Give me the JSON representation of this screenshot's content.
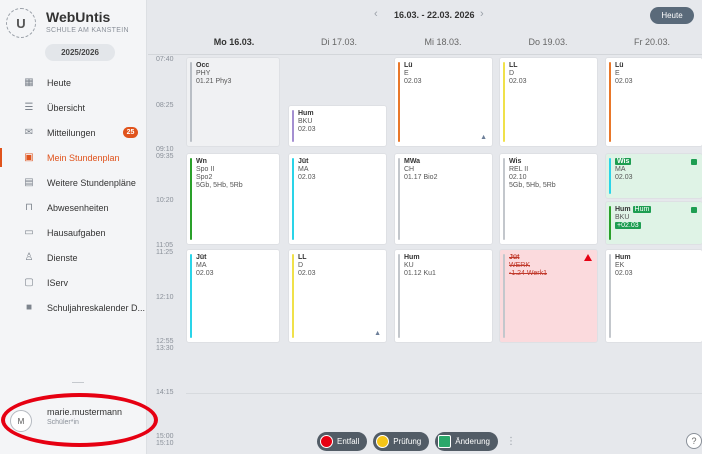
{
  "app": {
    "brand": "WebUntis",
    "school": "SCHULE AM KANSTEIN",
    "year": "2025/2026"
  },
  "sidebar": {
    "items": [
      {
        "label": "Heute",
        "icon": "grid-icon"
      },
      {
        "label": "Übersicht",
        "icon": "overview-icon"
      },
      {
        "label": "Mitteilungen",
        "icon": "mail-icon",
        "badge": "25"
      },
      {
        "label": "Mein Stundenplan",
        "icon": "calendar-icon",
        "active": true
      },
      {
        "label": "Weitere Stundenpläne",
        "icon": "calendar-grid-icon"
      },
      {
        "label": "Abwesenheiten",
        "icon": "absence-icon"
      },
      {
        "label": "Hausaufgaben",
        "icon": "homework-icon"
      },
      {
        "label": "Dienste",
        "icon": "service-icon"
      },
      {
        "label": "IServ",
        "icon": "iserv-icon"
      },
      {
        "label": "Schuljahreskalender D...",
        "icon": "book-icon"
      }
    ]
  },
  "user": {
    "initial": "M",
    "name": "marie.mustermann",
    "role": "Schüler*in"
  },
  "header": {
    "range": "16.03. - 22.03. 2026",
    "today": "Heute"
  },
  "days": [
    "Mo 16.03.",
    "Di 17.03.",
    "Mi 18.03.",
    "Do 19.03.",
    "Fr 20.03."
  ],
  "times": [
    "07:40",
    "08:25",
    "09:10",
    "09:35",
    "10:20",
    "11:05",
    "11:25",
    "12:10",
    "12:55",
    "13:30",
    "14:15",
    "15:00",
    "15:10"
  ],
  "lessons": [
    {
      "day": 0,
      "lines": [
        "Occ",
        "PHY",
        "01.21 Phy3"
      ],
      "color": "#b9bec5",
      "kind": "normal"
    },
    {
      "day": 0,
      "lines": [
        "Wn",
        "Spo II",
        "Spo2",
        "5Gb, 5Hb, 5Rb"
      ],
      "color": "#2aa02a",
      "kind": "normal"
    },
    {
      "day": 0,
      "lines": [
        "Jüt",
        "MA",
        "02.03"
      ],
      "color": "#2ad4e8",
      "kind": "normal"
    },
    {
      "day": 1,
      "lines": [
        "Hum",
        "BKU",
        "02.03"
      ],
      "color": "#a48fd1",
      "kind": "normal"
    },
    {
      "day": 1,
      "lines": [
        "Jüt",
        "MA",
        "02.03"
      ],
      "color": "#2ad4e8",
      "kind": "normal"
    },
    {
      "day": 1,
      "lines": [
        "LL",
        "D",
        "02.03"
      ],
      "color": "#f0e14a",
      "kind": "normal"
    },
    {
      "day": 2,
      "lines": [
        "Lü",
        "E",
        "02.03"
      ],
      "color": "#e8772a",
      "kind": "normal"
    },
    {
      "day": 2,
      "lines": [
        "MWa",
        "CH",
        "01.17 Bio2"
      ],
      "color": "#c3c7cc",
      "kind": "normal"
    },
    {
      "day": 2,
      "lines": [
        "Hum",
        "KU",
        "01.12 Ku1"
      ],
      "color": "#c3c7cc",
      "kind": "normal"
    },
    {
      "day": 3,
      "lines": [
        "LL",
        "D",
        "02.03"
      ],
      "color": "#f0e14a",
      "kind": "normal"
    },
    {
      "day": 3,
      "lines": [
        "Wis",
        "REL II",
        "02.10",
        "5Gb, 5Hb, 5Rb"
      ],
      "color": "#c3c7cc",
      "kind": "normal"
    },
    {
      "day": 3,
      "lines": [
        "Jüt",
        "WERK",
        "-1.24 Werk1"
      ],
      "color": "#c3c7cc",
      "kind": "cancel"
    },
    {
      "day": 4,
      "lines": [
        "Lü",
        "E",
        "02.03"
      ],
      "color": "#e8772a",
      "kind": "normal"
    },
    {
      "day": 4,
      "lines": [
        "Wis",
        "MA",
        "02.03"
      ],
      "color": "#2ad4e8",
      "kind": "change"
    },
    {
      "day": 4,
      "lines": [
        "Hum",
        "Hum",
        "BKU",
        "+02.03"
      ],
      "color": "#2aa02a",
      "kind": "change"
    },
    {
      "day": 4,
      "lines": [
        "Hum",
        "EK",
        "02.03"
      ],
      "color": "#c3c7cc",
      "kind": "normal"
    }
  ],
  "legend": [
    {
      "label": "Entfall",
      "color": "#e60012"
    },
    {
      "label": "Prüfung",
      "color": "#f5c518"
    },
    {
      "label": "Änderung",
      "color": "#2aa86a"
    }
  ],
  "colors": {
    "accent": "#e0531c",
    "cancel": "#fbdadd",
    "change": "#dff3e6",
    "highlight": "#e60012"
  }
}
